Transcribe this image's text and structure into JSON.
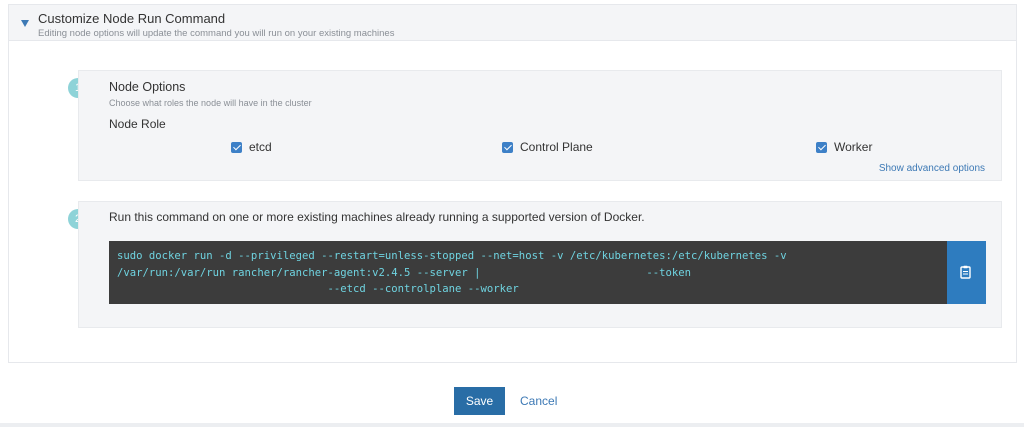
{
  "section": {
    "title": "Customize Node Run Command",
    "subtitle": "Editing node options will update the command you will run on your existing machines"
  },
  "step1": {
    "number": "1",
    "title": "Node Options",
    "subtitle": "Choose what roles the node will have in the cluster",
    "role_label": "Node Role",
    "roles": [
      {
        "label": "etcd",
        "checked": true
      },
      {
        "label": "Control Plane",
        "checked": true
      },
      {
        "label": "Worker",
        "checked": true
      }
    ],
    "advanced_link": "Show advanced options"
  },
  "step2": {
    "number": "2",
    "instruction": "Run this command on one or more existing machines already running a supported version of Docker.",
    "command_lines": [
      "sudo docker run -d --privileged --restart=unless-stopped --net=host -v /etc/kubernetes:/etc/kubernetes -v",
      "/var/run:/var/run rancher/rancher-agent:v2.4.5 --server |                          --token",
      "                                 --etcd --controlplane --worker"
    ]
  },
  "actions": {
    "save": "Save",
    "cancel": "Cancel"
  },
  "colors": {
    "accent": "#296da6",
    "link": "#3d79b5",
    "step_badge": "#8ed3d8",
    "command_bg": "#3c3c3c",
    "command_text": "#6fd3e0"
  },
  "icons": {
    "caret": "caret-down-icon",
    "copy": "copy-icon",
    "checkbox": "check-icon"
  }
}
